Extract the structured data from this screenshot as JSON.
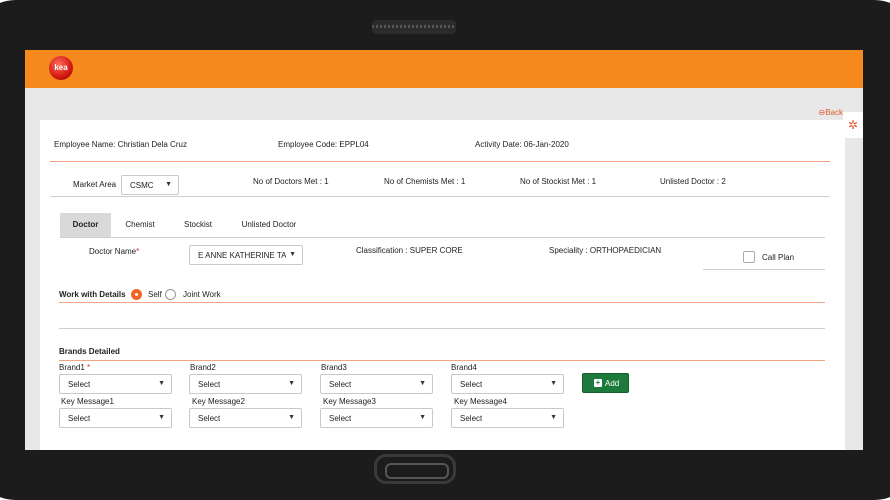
{
  "app": {
    "logo_text": "kea",
    "back_label": "Back"
  },
  "header": {
    "employee_name": "Employee Name:  Christian Dela Cruz",
    "employee_code": "Employee Code:  EPPL04",
    "activity_date": "Activity Date:  06-Jan-2020"
  },
  "summary": {
    "market_area_label": "Market Area",
    "market_area_value": "CSMC",
    "doctors_met": "No of Doctors Met : 1",
    "chemists_met": "No of Chemists Met : 1",
    "stockist_met": "No of Stockist Met : 1",
    "unlisted_doctor": "Unlisted Doctor : 2"
  },
  "tabs": [
    "Doctor",
    "Chemist",
    "Stockist",
    "Unlisted Doctor"
  ],
  "doctor": {
    "name_label": "Doctor Name",
    "required_mark": "*",
    "name_value": "E ANNE KATHERINE TA",
    "classification": "Classification : SUPER CORE",
    "speciality": "Speciality : ORTHOPAEDICIAN",
    "call_plan_label": "Call Plan"
  },
  "work_with": {
    "label": "Work with Details",
    "self_label": "Self",
    "joint_label": "Joint Work",
    "selected": "Self"
  },
  "brands": {
    "section_label": "Brands Detailed",
    "brand_labels": [
      "Brand1",
      "Brand2",
      "Brand3",
      "Brand4"
    ],
    "brand1_required": "*",
    "brand_values": [
      "Select",
      "Select",
      "Select",
      "Select"
    ],
    "key_message_labels": [
      "Key Message1",
      "Key Message2",
      "Key Message3",
      "Key Message4"
    ],
    "key_message_values": [
      "Select",
      "Select",
      "Select",
      "Select"
    ],
    "add_label": "Add"
  },
  "colors": {
    "accent": "#f68a1e",
    "add_button": "#1e7a3c",
    "divider": "#f2a482"
  }
}
